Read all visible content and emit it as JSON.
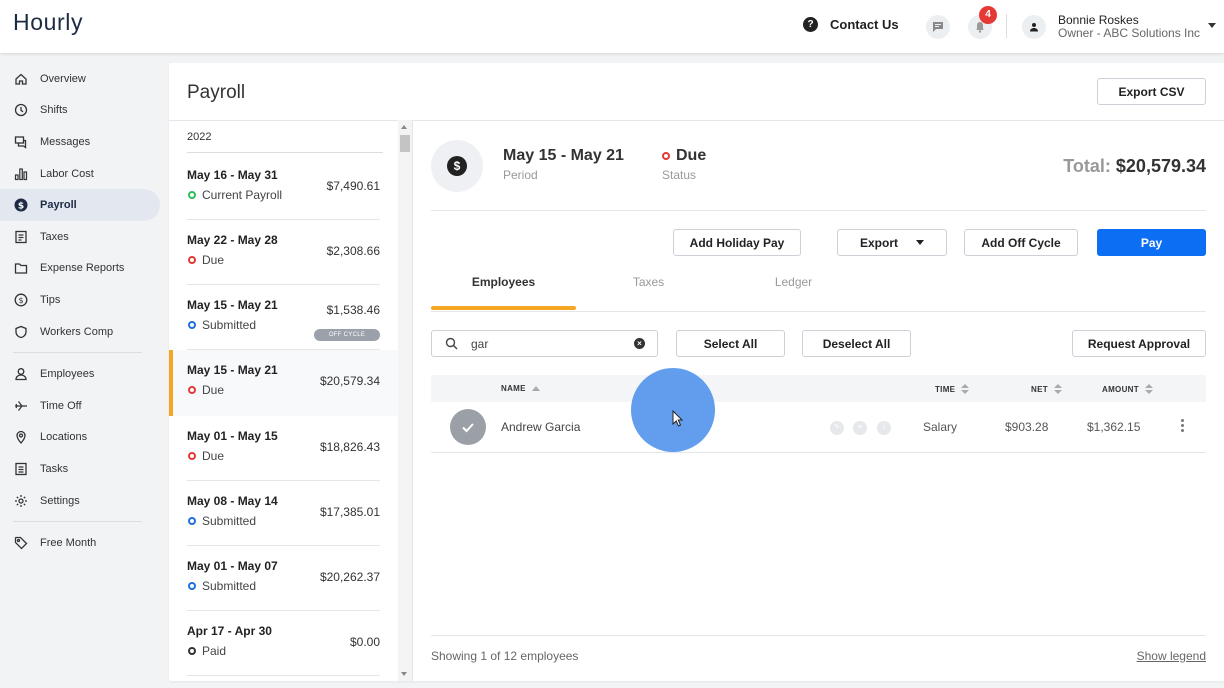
{
  "header": {
    "logo": "Hourly",
    "contact_label": "Contact Us",
    "notification_count": "4",
    "user_name": "Bonnie Roskes",
    "user_role": "Owner - ABC Solutions Inc"
  },
  "sidebar": {
    "items": [
      {
        "label": "Overview",
        "icon": "home-icon"
      },
      {
        "label": "Shifts",
        "icon": "clock-icon"
      },
      {
        "label": "Messages",
        "icon": "messages-icon"
      },
      {
        "label": "Labor Cost",
        "icon": "bar-chart-icon"
      },
      {
        "label": "Payroll",
        "icon": "dollar-icon"
      },
      {
        "label": "Taxes",
        "icon": "document-icon"
      },
      {
        "label": "Expense Reports",
        "icon": "folder-icon"
      },
      {
        "label": "Tips",
        "icon": "coin-icon"
      },
      {
        "label": "Workers Comp",
        "icon": "shield-icon"
      },
      {
        "label": "Employees",
        "icon": "person-icon"
      },
      {
        "label": "Time Off",
        "icon": "plane-icon"
      },
      {
        "label": "Locations",
        "icon": "pin-icon"
      },
      {
        "label": "Tasks",
        "icon": "list-icon"
      },
      {
        "label": "Settings",
        "icon": "gear-icon"
      },
      {
        "label": "Free Month",
        "icon": "tag-icon"
      }
    ],
    "active": "Payroll"
  },
  "page": {
    "title": "Payroll",
    "export_csv": "Export CSV"
  },
  "periods": {
    "year": "2022",
    "items": [
      {
        "dates": "May 16 - May 31",
        "status": "Current Payroll",
        "amount": "$7,490.61"
      },
      {
        "dates": "May 22 - May 28",
        "status": "Due",
        "amount": "$2,308.66"
      },
      {
        "dates": "May 15 - May 21",
        "status": "Submitted",
        "amount": "$1,538.46",
        "tag": "OFF CYCLE"
      },
      {
        "dates": "May 15 - May 21",
        "status": "Due",
        "amount": "$20,579.34"
      },
      {
        "dates": "May 01 - May 15",
        "status": "Due",
        "amount": "$18,826.43"
      },
      {
        "dates": "May 08 - May 14",
        "status": "Submitted",
        "amount": "$17,385.01"
      },
      {
        "dates": "May 01 - May 07",
        "status": "Submitted",
        "amount": "$20,262.37"
      },
      {
        "dates": "Apr 17 - Apr 30",
        "status": "Paid",
        "amount": "$0.00"
      }
    ]
  },
  "detail": {
    "period": "May 15 - May 21",
    "period_label": "Period",
    "status": "Due",
    "status_label": "Status",
    "total_label": "Total:",
    "total_value": "$20,579.34",
    "actions": {
      "holiday": "Add Holiday Pay",
      "export": "Export",
      "off_cycle": "Add Off Cycle",
      "pay": "Pay"
    },
    "tabs": [
      "Employees",
      "Taxes",
      "Ledger"
    ],
    "search_value": "gar",
    "select_all": "Select All",
    "deselect_all": "Deselect All",
    "request_approval": "Request Approval",
    "columns": {
      "name": "NAME",
      "time": "TIME",
      "net": "NET",
      "amount": "AMOUNT"
    },
    "rows": [
      {
        "name": "Andrew Garcia",
        "time": "Salary",
        "net": "$903.28",
        "amount": "$1,362.15"
      }
    ],
    "footer_count": "Showing 1 of 12 employees",
    "show_legend": "Show legend"
  },
  "colors": {
    "accent": "#f5a623",
    "primary": "#0b6ef3",
    "due": "#e53935",
    "current": "#2ebd5a",
    "submitted": "#1e6fe0",
    "paid": "#333333"
  }
}
